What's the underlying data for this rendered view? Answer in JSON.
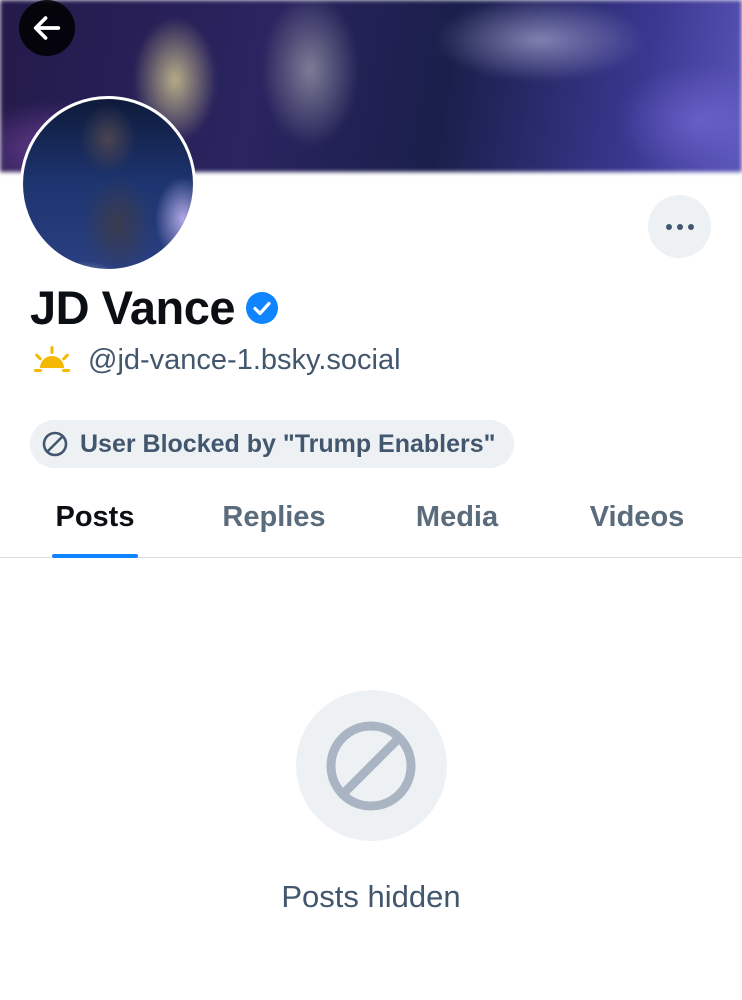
{
  "profile": {
    "display_name": "JD Vance",
    "handle": "@jd-vance-1.bsky.social",
    "verified": true,
    "handle_icon": "sun-icon"
  },
  "header": {
    "back_icon": "arrow-left-icon",
    "more_icon": "ellipsis-icon"
  },
  "moderation": {
    "label": "User Blocked by \"Trump Enablers\"",
    "icon": "block-icon"
  },
  "tabs": [
    {
      "label": "Posts",
      "active": true
    },
    {
      "label": "Replies",
      "active": false
    },
    {
      "label": "Media",
      "active": false
    },
    {
      "label": "Videos",
      "active": false
    }
  ],
  "empty_state": {
    "icon": "block-icon",
    "message": "Posts hidden"
  },
  "colors": {
    "accent": "#1083fe",
    "verified": "#1083fe",
    "text_primary": "#0b0f14",
    "text_secondary": "#42576e",
    "pill_bg": "#eef1f4",
    "sun": "#f5b800"
  }
}
